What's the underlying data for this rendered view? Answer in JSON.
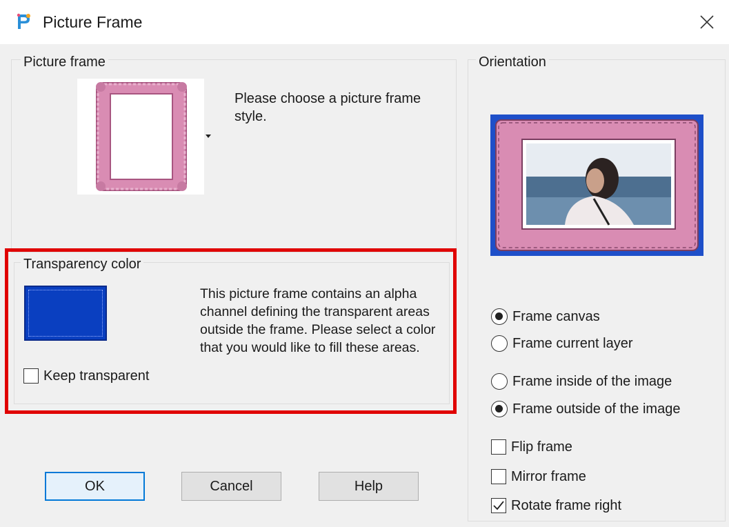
{
  "window": {
    "title": "Picture Frame",
    "app_icon": "paintshop-pro-icon",
    "close_icon": "close-icon"
  },
  "picture_frame_group": {
    "label": "Picture frame",
    "instruction": "Please choose a picture frame style."
  },
  "transparency_group": {
    "label": "Transparency color",
    "swatch_color": "#0a3fc0",
    "description": "This picture frame contains an alpha channel defining the transparent areas outside the frame.  Please select a color that you would like to fill these areas.",
    "keep_transparent": {
      "label": "Keep transparent",
      "checked": false
    }
  },
  "orientation_group": {
    "label": "Orientation",
    "frame_target": [
      {
        "label": "Frame canvas",
        "selected": true
      },
      {
        "label": "Frame current layer",
        "selected": false
      }
    ],
    "frame_position": [
      {
        "label": "Frame inside of the image",
        "selected": false
      },
      {
        "label": "Frame outside of the image",
        "selected": true
      }
    ],
    "options": [
      {
        "label": "Flip frame",
        "checked": false
      },
      {
        "label": "Mirror frame",
        "checked": false
      },
      {
        "label": "Rotate frame right",
        "checked": true
      }
    ]
  },
  "buttons": {
    "ok": "OK",
    "cancel": "Cancel",
    "help": "Help"
  },
  "colors": {
    "highlight": "#e00000",
    "frame_pink": "#d98cb3",
    "default_button_border": "#0078d7"
  }
}
